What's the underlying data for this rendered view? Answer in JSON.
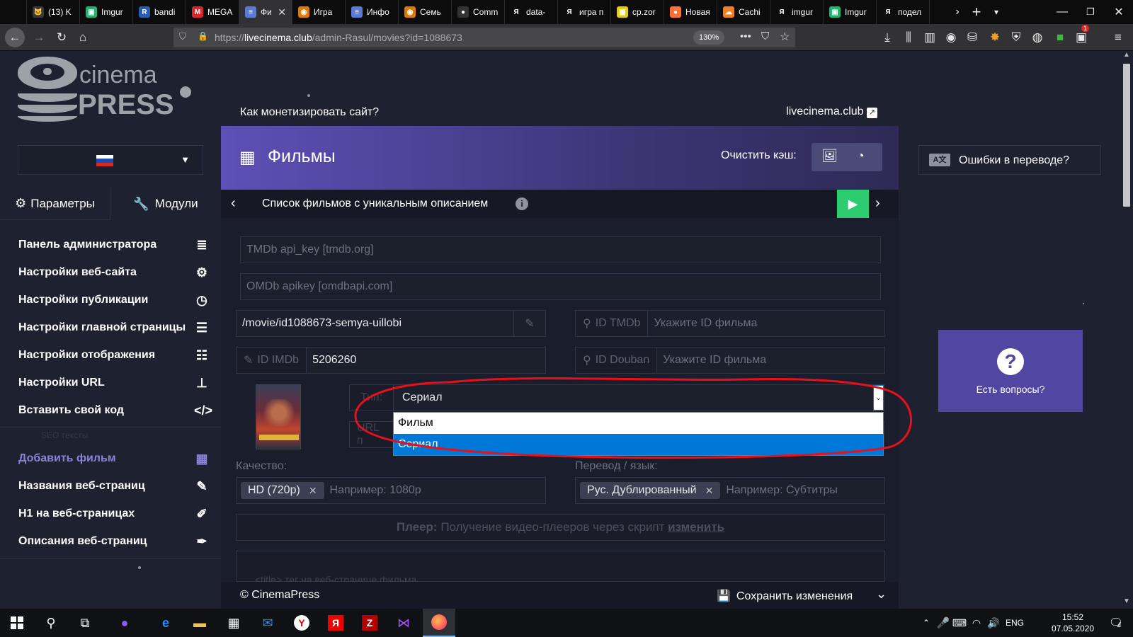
{
  "browser": {
    "tabs": [
      {
        "label": "(13) K",
        "fav_color": "#3a3a3a",
        "fav_text": "🐱"
      },
      {
        "label": "Imgur",
        "fav_color": "#1bb76e",
        "fav_text": "▣"
      },
      {
        "label": "bandi",
        "fav_color": "#2a5db0",
        "fav_text": "R"
      },
      {
        "label": "MEGA",
        "fav_color": "#d9272e",
        "fav_text": "M"
      },
      {
        "label": "Фи",
        "fav_color": "#5c7bd8",
        "fav_text": "≡"
      },
      {
        "label": "Игра",
        "fav_color": "#e07b00",
        "fav_text": "◉"
      },
      {
        "label": "Инфо",
        "fav_color": "#5c7bd8",
        "fav_text": "≡"
      },
      {
        "label": "Семь",
        "fav_color": "#e07b00",
        "fav_text": "◉"
      },
      {
        "label": "Comm",
        "fav_color": "#333333",
        "fav_text": "●"
      },
      {
        "label": "data-",
        "fav_color": "#0c0c0d",
        "fav_text": "Я"
      },
      {
        "label": "игра п",
        "fav_color": "#0c0c0d",
        "fav_text": "Я"
      },
      {
        "label": "cp.zor",
        "fav_color": "#e8d000",
        "fav_text": "▦"
      },
      {
        "label": "Новая",
        "fav_color": "#ff7139",
        "fav_text": "●"
      },
      {
        "label": "Cachi",
        "fav_color": "#f38020",
        "fav_text": "☁"
      },
      {
        "label": "imgur",
        "fav_color": "#0c0c0d",
        "fav_text": "Я"
      },
      {
        "label": "Imgur",
        "fav_color": "#1bb76e",
        "fav_text": "▣"
      },
      {
        "label": "подел",
        "fav_color": "#0c0c0d",
        "fav_text": "Я"
      }
    ],
    "url_prefix": "https://",
    "url_host": "livecinema.club",
    "url_path": "/admin-Rasul/movies?id=1088673",
    "zoom": "130%",
    "addon_badge": "1"
  },
  "sidebar": {
    "logo_line1": "cinema",
    "logo_line2": "PRESS",
    "tab_params": "Параметры",
    "tab_modules": "Модули",
    "items": [
      {
        "label": "Панель администратора",
        "icon": "database-icon",
        "glyph": "≣"
      },
      {
        "label": "Настройки веб-сайта",
        "icon": "gear-icon",
        "glyph": "⚙"
      },
      {
        "label": "Настройки публикации",
        "icon": "clock-icon",
        "glyph": "◷"
      },
      {
        "label": "Настройки главной страницы",
        "icon": "bars-icon",
        "glyph": "☰"
      },
      {
        "label": "Настройки отображения",
        "icon": "list-icon",
        "glyph": "☷"
      },
      {
        "label": "Настройки URL",
        "icon": "sitemap-icon",
        "glyph": "⊥"
      },
      {
        "label": "Вставить свой код",
        "icon": "code-icon",
        "glyph": "</>"
      }
    ],
    "seo_section": "SEO тексты",
    "seo_items": [
      {
        "label": "Добавить фильм",
        "icon": "film-icon",
        "glyph": "▦"
      },
      {
        "label": "Названия веб-страниц",
        "icon": "pencil-icon",
        "glyph": "✎"
      },
      {
        "label": "H1 на веб-страницах",
        "icon": "brush-icon",
        "glyph": "✐"
      },
      {
        "label": "Описания веб-страниц",
        "icon": "pen-icon",
        "glyph": "✒"
      }
    ]
  },
  "topline": {
    "monetize": "Как монетизировать сайт?",
    "site": "livecinema.club"
  },
  "header": {
    "title": "Фильмы",
    "cache_label": "Очистить кэш:"
  },
  "subnav": {
    "title": "Список фильмов с уникальным описанием"
  },
  "form": {
    "tmdb_key_ph": "TMDb api_key [tmdb.org]",
    "omdb_key_ph": "OMDb apikey [omdbapi.com]",
    "url_value": "/movie/id1088673-semya-uillobi",
    "id_tmdb_label": "ID TMDb",
    "id_tmdb_ph": "Укажите ID фильма",
    "id_imdb_label": "ID IMDb",
    "id_imdb_value": "5206260",
    "id_douban_label": "ID Douban",
    "id_douban_ph": "Укажите ID фильма",
    "type_label": "Тип:",
    "type_value": "Сериал",
    "type_options": [
      "Фильм",
      "Сериал"
    ],
    "url_label": "URL п",
    "quality_label": "Качество:",
    "quality_chip": "HD (720p)",
    "quality_ph": "Например: 1080p",
    "translate_label": "Перевод / язык:",
    "translate_chip": "Рус. Дублированный",
    "translate_ph": "Например: Субтитры",
    "player_label": "Плеер:",
    "player_text": "Получение видео-плееров через скрипт",
    "player_link": "изменить",
    "title_tag_ph": "<title> тег на веб-странице фильма"
  },
  "right": {
    "translate_errors": "Ошибки в переводе?",
    "questions": "Есть вопросы?"
  },
  "footer": {
    "copyright": "© CinemaPress",
    "save": "Сохранить изменения"
  },
  "taskbar": {
    "lang": "ENG",
    "time": "15:52",
    "date": "07.05.2020",
    "notif": "4"
  },
  "colors": {
    "accent": "#5d50b7",
    "active_menu": "#8a83d8",
    "green": "#2ecc71",
    "select_blue": "#0078d7",
    "annotation_red": "#e8101b"
  }
}
